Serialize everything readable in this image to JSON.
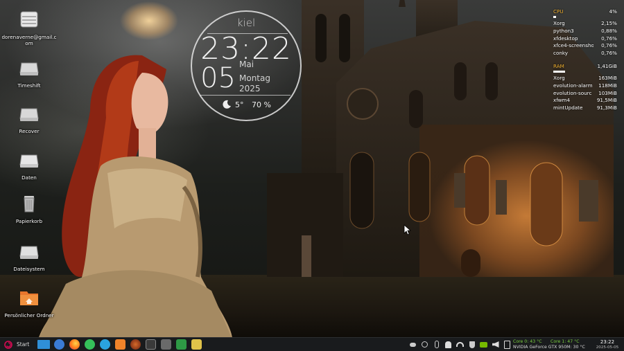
{
  "desktop": {
    "icons": [
      {
        "label": "dorenaverne@gmail.com",
        "icon": "drive-icon"
      },
      {
        "label": "Timeshift",
        "icon": "drive-icon"
      },
      {
        "label": "Recover",
        "icon": "drive-icon"
      },
      {
        "label": "Daten",
        "icon": "drive-icon"
      },
      {
        "label": "Papierkorb",
        "icon": "trash-icon"
      },
      {
        "label": "Dateisystem",
        "icon": "drive-icon"
      },
      {
        "label": "Persönlicher Ordner",
        "icon": "home-folder-icon"
      }
    ]
  },
  "clock_widget": {
    "city": "kiel",
    "time": "23:22",
    "day": "05",
    "month": "Mai",
    "weekday": "Montag",
    "year": "2025",
    "temperature": "5°",
    "humidity": "70 %",
    "weather_icon": "moon-cloud-icon"
  },
  "conky": {
    "cpu": {
      "label": "CPU",
      "value": "4%",
      "usage_fraction": 0.04
    },
    "cpu_processes": [
      {
        "name": "Xorg",
        "value": "2,15%"
      },
      {
        "name": "python3",
        "value": "0,88%"
      },
      {
        "name": "xfdesktop",
        "value": "0,76%"
      },
      {
        "name": "xfce4-screensho",
        "value": "0,76%"
      },
      {
        "name": "conky",
        "value": "0,76%"
      }
    ],
    "ram": {
      "label": "RAM",
      "value": "1,41GiB",
      "usage_fraction": 0.18
    },
    "ram_processes": [
      {
        "name": "Xorg",
        "value": "163MiB"
      },
      {
        "name": "evolution-alarm",
        "value": "118MiB"
      },
      {
        "name": "evolution-sourc",
        "value": "103MiB"
      },
      {
        "name": "xfwm4",
        "value": "91,5MiB"
      },
      {
        "name": "mintUpdate",
        "value": "91,3MiB"
      }
    ]
  },
  "taskbar": {
    "start_label": "Start",
    "apps": [
      {
        "name": "show-desktop",
        "icon": "show-desktop-icon",
        "color": "#2f8fd8"
      },
      {
        "name": "thunderbird",
        "icon": "thunderbird-icon",
        "color": "#3a7bd5"
      },
      {
        "name": "firefox",
        "icon": "firefox-icon",
        "color": "#ff7a1a"
      },
      {
        "name": "whatsapp",
        "icon": "whatsapp-icon",
        "color": "#35c15a"
      },
      {
        "name": "telegram",
        "icon": "telegram-icon",
        "color": "#2aa3e0"
      },
      {
        "name": "software-manager",
        "icon": "software-store-icon",
        "color": "#f0832a"
      },
      {
        "name": "game",
        "icon": "game-icon",
        "color": "#a04020"
      },
      {
        "name": "terminal",
        "icon": "terminal-icon",
        "color": "#3a3a3a"
      },
      {
        "name": "download",
        "icon": "download-icon",
        "color": "#6a6a6a"
      },
      {
        "name": "spreadsheet",
        "icon": "spreadsheet-icon",
        "color": "#2e9a45"
      },
      {
        "name": "text-editor",
        "icon": "text-editor-icon",
        "color": "#e0c24a"
      }
    ],
    "tray_icons": [
      "toggle-icon",
      "clock-status-icon",
      "bluetooth-icon",
      "notification-bell-icon",
      "wifi-icon",
      "shield-icon",
      "nvidia-icon",
      "volume-icon",
      "clipboard-icon"
    ],
    "gpu": {
      "core0": "Core 0: 43 °C",
      "core1": "Core 1: 47 °C",
      "name": "NVIDIA GeForce GTX 950M: 30 °C"
    },
    "clock": {
      "time": "23:22",
      "date": "2025-05-05"
    }
  }
}
